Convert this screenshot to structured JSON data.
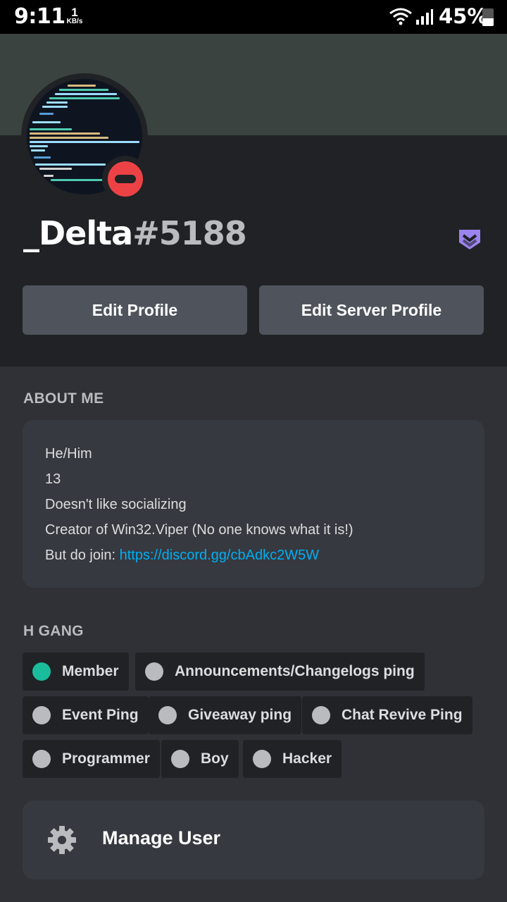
{
  "status_bar": {
    "time": "9:11",
    "net_speed_value": "1",
    "net_speed_unit": "KB/s",
    "battery_percent": "45%",
    "battery_level": 0.45,
    "icons": [
      "wifi-icon",
      "signal-icon",
      "battery-icon"
    ]
  },
  "profile": {
    "username": "_Delta",
    "discriminator": "#5188",
    "status": "do-not-disturb",
    "badge_icon": "nitro-guild-badge-icon",
    "colors": {
      "dnd": "#ed4245",
      "badge": "#9c84ef",
      "link": "#00aff4",
      "member_role": "#1abc9c"
    }
  },
  "actions": {
    "edit_profile": "Edit Profile",
    "edit_server_profile": "Edit Server Profile"
  },
  "about": {
    "title": "ABOUT ME",
    "lines": [
      "He/Him",
      "13",
      "Doesn't like socializing",
      "Creator of Win32.Viper (No one knows what it is!)"
    ],
    "join_prefix": "But do join: ",
    "join_link": "https://discord.gg/cbAdkc2W5W"
  },
  "roles": {
    "title": "H GANG",
    "items": [
      {
        "name": "Member",
        "color": "#1abc9c"
      },
      {
        "name": "Announcements/Changelogs ping",
        "color": "#b9bbbe"
      },
      {
        "name": "Event Ping",
        "color": "#b9bbbe"
      },
      {
        "name": "Giveaway ping",
        "color": "#b9bbbe"
      },
      {
        "name": "Chat Revive Ping",
        "color": "#b9bbbe"
      },
      {
        "name": "Programmer",
        "color": "#b9bbbe"
      },
      {
        "name": "Boy",
        "color": "#b9bbbe"
      },
      {
        "name": "Hacker",
        "color": "#b9bbbe"
      }
    ]
  },
  "manage": {
    "label": "Manage User",
    "icon": "gear-icon"
  }
}
